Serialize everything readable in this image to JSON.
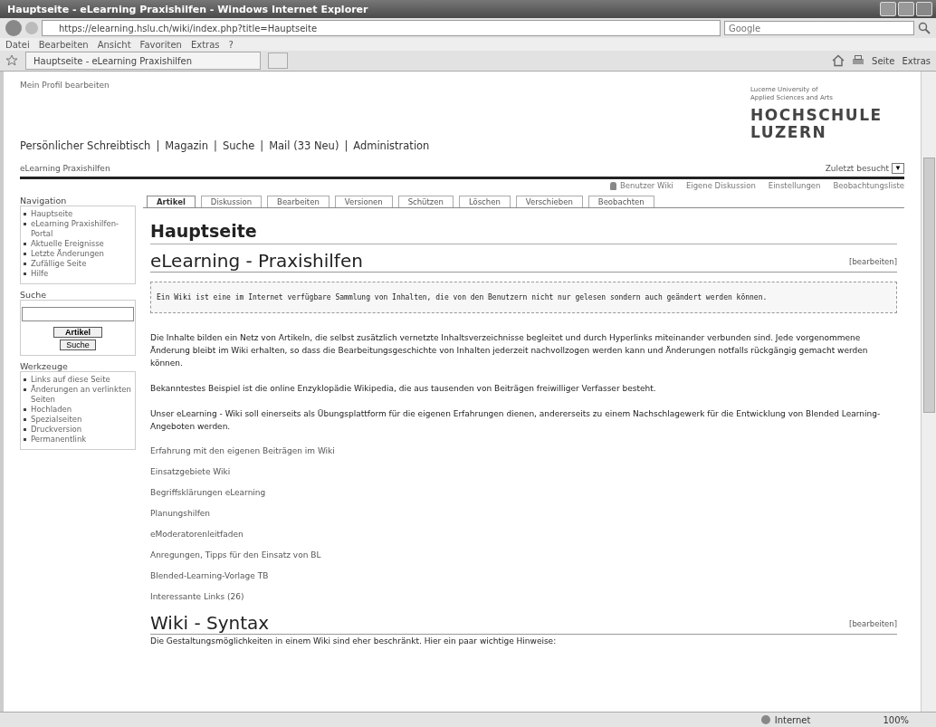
{
  "browser": {
    "title": "Hauptseite - eLearning Praxishilfen - Windows Internet Explorer",
    "address": "https://elearning.hslu.ch/wiki/index.php?title=Hauptseite",
    "search_placeholder": "Google",
    "menu": [
      "Datei",
      "Bearbeiten",
      "Ansicht",
      "Favoriten",
      "Extras",
      "?"
    ],
    "tab_title": "Hauptseite - eLearning Praxishilfen",
    "toolbar": [
      "Seite",
      "Extras"
    ],
    "status": "Internet",
    "zoom": "100%"
  },
  "page": {
    "user_name": "Mein Profil bearbeiten",
    "logo": {
      "tagline": [
        "Lucerne University of",
        "Applied Sciences and Arts"
      ],
      "name": [
        "HOCHSCHULE",
        "LUZERN"
      ]
    },
    "nav_separator": "|",
    "nav": [
      "Persönlicher Schreibtisch",
      "Magazin",
      "Suche",
      "Mail (33 Neu)",
      "Administration"
    ],
    "breadcrumb": "eLearning Praxishilfen",
    "recent": "Zuletzt besucht",
    "recent_button": "▼",
    "user_links": [
      "Benutzer Wiki",
      "Eigene Diskussion",
      "Einstellungen",
      "Beobachtungsliste"
    ],
    "tabs": [
      {
        "label": "Artikel",
        "selected": true
      },
      {
        "label": "Diskussion",
        "selected": false
      },
      {
        "label": "Bearbeiten",
        "selected": false
      },
      {
        "label": "Versionen",
        "selected": false
      },
      {
        "label": "Schützen",
        "selected": false
      },
      {
        "label": "Löschen",
        "selected": false
      },
      {
        "label": "Verschieben",
        "selected": false
      },
      {
        "label": "Beobachten",
        "selected": false
      }
    ],
    "sidebar": [
      {
        "kind": "list",
        "title": "Navigation",
        "items": [
          "Hauptseite",
          "eLearning Praxishilfen-Portal",
          "Aktuelle Ereignisse",
          "Letzte Änderungen",
          "Zufällige Seite",
          "Hilfe"
        ]
      },
      {
        "kind": "search",
        "title": "Suche",
        "items": [
          "Artikel",
          "Suche"
        ]
      },
      {
        "kind": "list",
        "title": "Werkzeuge",
        "items": [
          "Links auf diese Seite",
          "Änderungen an verlinkten Seiten",
          "Hochladen",
          "Spezialseiten",
          "Druckversion",
          "Permanentlink"
        ]
      }
    ],
    "heading": "Hauptseite",
    "sections": [
      {
        "title": "eLearning - Praxishilfen",
        "edit": "[bearbeiten]",
        "blocks": [
          {
            "kind": "pre",
            "text": "Ein Wiki ist eine im Internet verfügbare Sammlung von Inhalten, die von den Benutzern nicht nur gelesen sondern auch geändert werden können."
          },
          {
            "kind": "para",
            "text": "Die Inhalte bilden ein Netz von Artikeln, die selbst zusätzlich vernetzte Inhaltsverzeichnisse begleitet und durch Hyperlinks miteinander verbunden sind. Jede vorgenommene Änderung bleibt im Wiki erhalten, so dass die Bearbeitungsgeschichte von Inhalten jederzeit nachvollzogen werden kann und Änderungen notfalls rückgängig gemacht werden können."
          },
          {
            "kind": "para",
            "text": "Bekanntestes Beispiel ist die online Enzyklopädie Wikipedia, die aus tausenden von Beiträgen freiwilliger Verfasser besteht."
          },
          {
            "kind": "para",
            "text": "Unser eLearning - Wiki soll einerseits als Übungsplattform für die eigenen Erfahrungen dienen, andererseits zu einem Nachschlagewerk für die Entwicklung von Blended Learning-Angeboten werden."
          },
          {
            "kind": "link",
            "text": "Erfahrung mit den eigenen Beiträgen im Wiki"
          },
          {
            "kind": "link",
            "text": "Einsatzgebiete Wiki"
          },
          {
            "kind": "link",
            "text": "Begriffsklärungen eLearning"
          },
          {
            "kind": "link",
            "text": "Planungshilfen"
          },
          {
            "kind": "link",
            "text": "eModeratorenleitfaden"
          },
          {
            "kind": "link",
            "text": "Anregungen, Tipps für den Einsatz von BL"
          },
          {
            "kind": "link",
            "text": "Blended-Learning-Vorlage TB"
          },
          {
            "kind": "link",
            "text": "Interessante Links (26)"
          }
        ]
      },
      {
        "title": "Wiki - Syntax",
        "edit": "[bearbeiten]",
        "blocks": [
          {
            "kind": "para",
            "text": "Die Gestaltungsmöglichkeiten in einem Wiki sind eher beschränkt. Hier ein paar wichtige Hinweise:"
          }
        ]
      }
    ]
  }
}
